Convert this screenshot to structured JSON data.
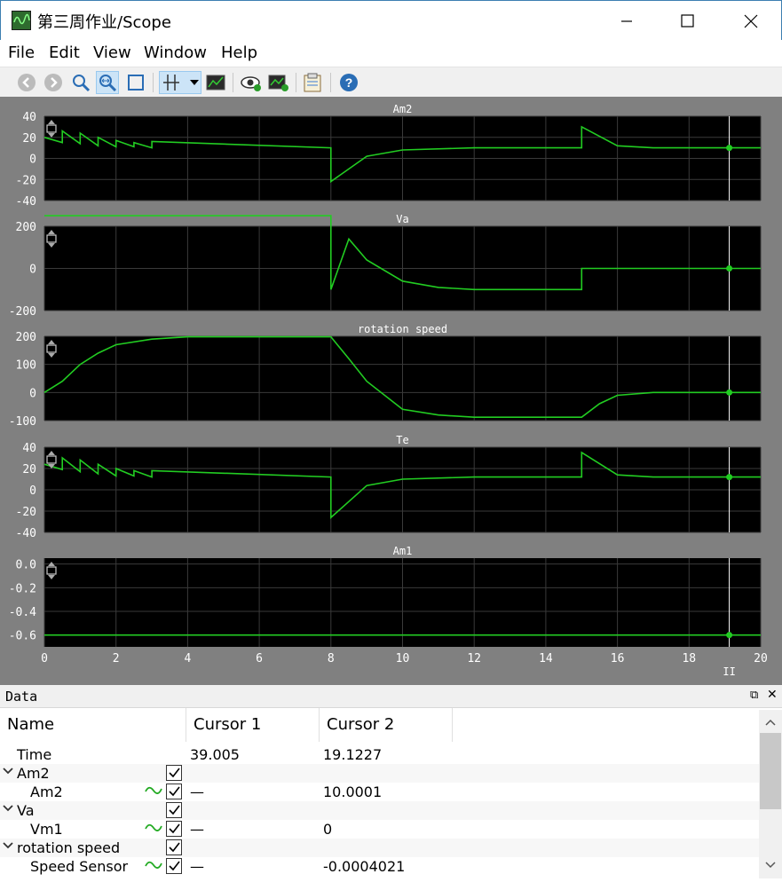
{
  "window": {
    "title": "第三周作业/Scope"
  },
  "menu": [
    "File",
    "Edit",
    "View",
    "Window",
    "Help"
  ],
  "toolbar": {
    "icons": [
      "back-icon",
      "forward-icon",
      "zoom-icon",
      "zoom-fit-x-icon",
      "zoom-extents-icon",
      "cursor-measure-icon",
      "dropdown-arrow-icon",
      "signal-stats-icon",
      "view-signal-icon",
      "add-signal-icon",
      "properties-icon",
      "help-icon"
    ]
  },
  "plots": {
    "titles": [
      "Am2",
      "Va",
      "rotation speed",
      "Te",
      "Am1"
    ],
    "cursor_label": "II",
    "x_ticks": [
      "0",
      "2",
      "4",
      "6",
      "8",
      "10",
      "12",
      "14",
      "16",
      "18",
      "20"
    ],
    "y_ticks": [
      [
        "40",
        "20",
        "0",
        "-20",
        "-40"
      ],
      [
        "200",
        "0",
        "-200"
      ],
      [
        "200",
        "100",
        "0",
        "-100"
      ],
      [
        "40",
        "20",
        "0",
        "-20",
        "-40"
      ],
      [
        "0.0",
        "-0.2",
        "-0.4",
        "-0.6"
      ]
    ]
  },
  "colors": {
    "trace": "#22cc22",
    "plot_bg": "#000000",
    "frame_bg": "#808080",
    "grid": "#3a3a3a",
    "cursor": "#ffffff"
  },
  "chart_data": [
    {
      "type": "line",
      "title": "Am2",
      "xlim": [
        0,
        20
      ],
      "ylim": [
        -40,
        40
      ],
      "series": [
        {
          "x": [
            0,
            0.5,
            0.5,
            1,
            1,
            1.5,
            1.5,
            2,
            2,
            2.5,
            2.5,
            3,
            3,
            8,
            8,
            9,
            10,
            12,
            15,
            15,
            16,
            17,
            20
          ],
          "y": [
            20,
            15,
            26,
            14,
            24,
            12,
            20,
            11,
            17,
            11,
            15,
            10,
            16,
            10,
            -22,
            2,
            8,
            10,
            10,
            30,
            12,
            10,
            10
          ]
        }
      ]
    },
    {
      "type": "line",
      "title": "Va",
      "xlim": [
        0,
        20
      ],
      "ylim": [
        -200,
        200
      ],
      "series": [
        {
          "x": [
            0,
            8,
            8,
            8.5,
            9,
            10,
            11,
            12,
            15,
            15,
            20
          ],
          "y": [
            250,
            250,
            -100,
            140,
            40,
            -60,
            -90,
            -100,
            -100,
            0,
            0
          ]
        }
      ]
    },
    {
      "type": "line",
      "title": "rotation speed",
      "xlim": [
        0,
        20
      ],
      "ylim": [
        -100,
        200
      ],
      "series": [
        {
          "x": [
            0,
            0.5,
            1,
            1.5,
            2,
            3,
            4,
            8,
            8.5,
            9,
            10,
            11,
            12,
            15,
            15.5,
            16,
            17,
            20
          ],
          "y": [
            0,
            40,
            100,
            140,
            170,
            190,
            198,
            198,
            120,
            40,
            -60,
            -80,
            -88,
            -88,
            -40,
            -10,
            0,
            0
          ]
        }
      ]
    },
    {
      "type": "line",
      "title": "Te",
      "xlim": [
        0,
        20
      ],
      "ylim": [
        -40,
        40
      ],
      "series": [
        {
          "x": [
            0,
            0.5,
            0.5,
            1,
            1,
            1.5,
            1.5,
            2,
            2,
            2.5,
            2.5,
            3,
            3,
            8,
            8,
            9,
            10,
            12,
            15,
            15,
            16,
            17,
            20
          ],
          "y": [
            24,
            19,
            30,
            17,
            28,
            15,
            24,
            13,
            20,
            13,
            18,
            12,
            18,
            12,
            -26,
            4,
            10,
            12,
            12,
            35,
            14,
            12,
            12
          ]
        }
      ]
    },
    {
      "type": "line",
      "title": "Am1",
      "xlim": [
        0,
        20
      ],
      "ylim": [
        -0.7,
        0.05
      ],
      "series": [
        {
          "x": [
            0,
            20
          ],
          "y": [
            -0.6,
            -0.6
          ]
        }
      ]
    }
  ],
  "cursor_time": 19.1227,
  "data_panel": {
    "title": "Data",
    "columns": [
      "Name",
      "Cursor 1",
      "Cursor 2"
    ],
    "rows": [
      {
        "name": "Time",
        "c1": "39.005",
        "c2": "19.1227",
        "kind": "plain"
      },
      {
        "name": "Am2",
        "c1": "",
        "c2": "",
        "kind": "group"
      },
      {
        "name": "Am2",
        "c1": "—",
        "c2": "10.0001",
        "kind": "signal"
      },
      {
        "name": "Va",
        "c1": "",
        "c2": "",
        "kind": "group"
      },
      {
        "name": "Vm1",
        "c1": "—",
        "c2": "0",
        "kind": "signal"
      },
      {
        "name": "rotation speed",
        "c1": "",
        "c2": "",
        "kind": "group"
      },
      {
        "name": "Speed Sensor",
        "c1": "—",
        "c2": "-0.0004021",
        "kind": "signal"
      }
    ]
  }
}
